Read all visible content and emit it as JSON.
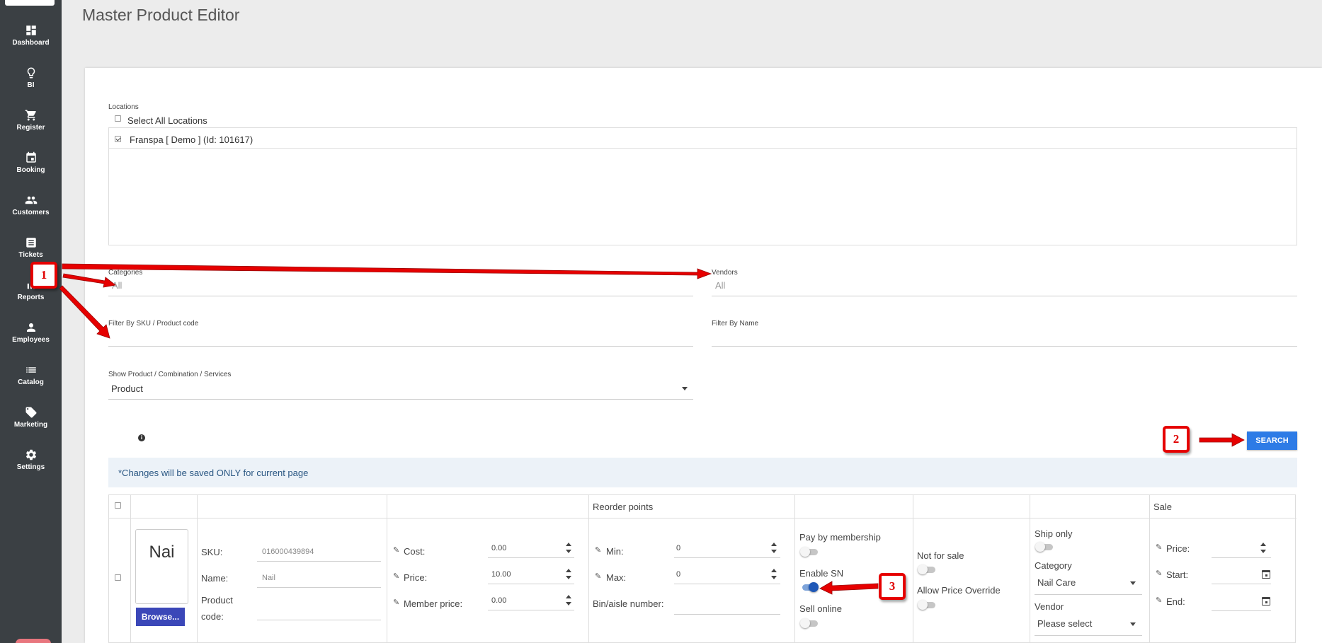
{
  "sidebar": {
    "items": [
      {
        "label": "Dashboard",
        "icon": "dashboard-icon"
      },
      {
        "label": "BI",
        "icon": "lightbulb-icon"
      },
      {
        "label": "Register",
        "icon": "cart-icon"
      },
      {
        "label": "Booking",
        "icon": "calendar-icon"
      },
      {
        "label": "Customers",
        "icon": "people-icon"
      },
      {
        "label": "Tickets",
        "icon": "ticket-icon"
      },
      {
        "label": "Reports",
        "icon": "bar-chart-icon"
      },
      {
        "label": "Employees",
        "icon": "person-icon"
      },
      {
        "label": "Catalog",
        "icon": "list-icon"
      },
      {
        "label": "Marketing",
        "icon": "tag-icon"
      },
      {
        "label": "Settings",
        "icon": "gear-icon"
      }
    ]
  },
  "header": {
    "title": "Master Product Editor"
  },
  "filters": {
    "locations_label": "Locations",
    "select_all_label": "Select All Locations",
    "location_item": "Franspa [ Demo ] (Id: 101617)",
    "categories_label": "Categories",
    "categories_value": "All",
    "vendors_label": "Vendors",
    "vendors_value": "All",
    "sku_label": "Filter By SKU / Product code",
    "name_label": "Filter By Name",
    "show_label": "Show Product / Combination / Services",
    "show_value": "Product",
    "search_button": "SEARCH"
  },
  "notice": "*Changes will be saved ONLY for current page",
  "table": {
    "headers": {
      "reorder_points": "Reorder points",
      "sale": "Sale"
    },
    "row": {
      "thumb_text": "Nai",
      "browse_label": "Browse...",
      "sku_label": "SKU:",
      "sku_value": "016000439894",
      "name_label": "Name:",
      "name_value": "Nail",
      "product_code_label_1": "Product",
      "product_code_label_2": "code:",
      "cost_label": "Cost:",
      "cost_value": "0.00",
      "price_label": "Price:",
      "price_value": "10.00",
      "member_price_label": "Member price:",
      "member_price_value": "0.00",
      "min_label": "Min:",
      "min_value": "0",
      "max_label": "Max:",
      "max_value": "0",
      "bin_label": "Bin/aisle number:",
      "pay_membership_label": "Pay by membership",
      "enable_sn_label": "Enable SN",
      "sell_online_label": "Sell online",
      "not_for_sale_label": "Not for sale",
      "allow_override_label": "Allow Price Override",
      "ship_only_label": "Ship only",
      "category_label": "Category",
      "category_value": "Nail Care",
      "vendor_label": "Vendor",
      "vendor_value": "Please select",
      "sale_price_label": "Price:",
      "sale_start_label": "Start:",
      "sale_end_label": "End:"
    }
  },
  "toggles": {
    "pay_membership": false,
    "enable_sn": true,
    "sell_online": false,
    "not_for_sale": false,
    "allow_override": false,
    "ship_only": false
  },
  "annotations": [
    "1",
    "2",
    "3"
  ],
  "colors": {
    "sidebar": "#3b4044",
    "accent": "#2d7be6",
    "annotation": "#e60000",
    "browse": "#3b47b8"
  }
}
